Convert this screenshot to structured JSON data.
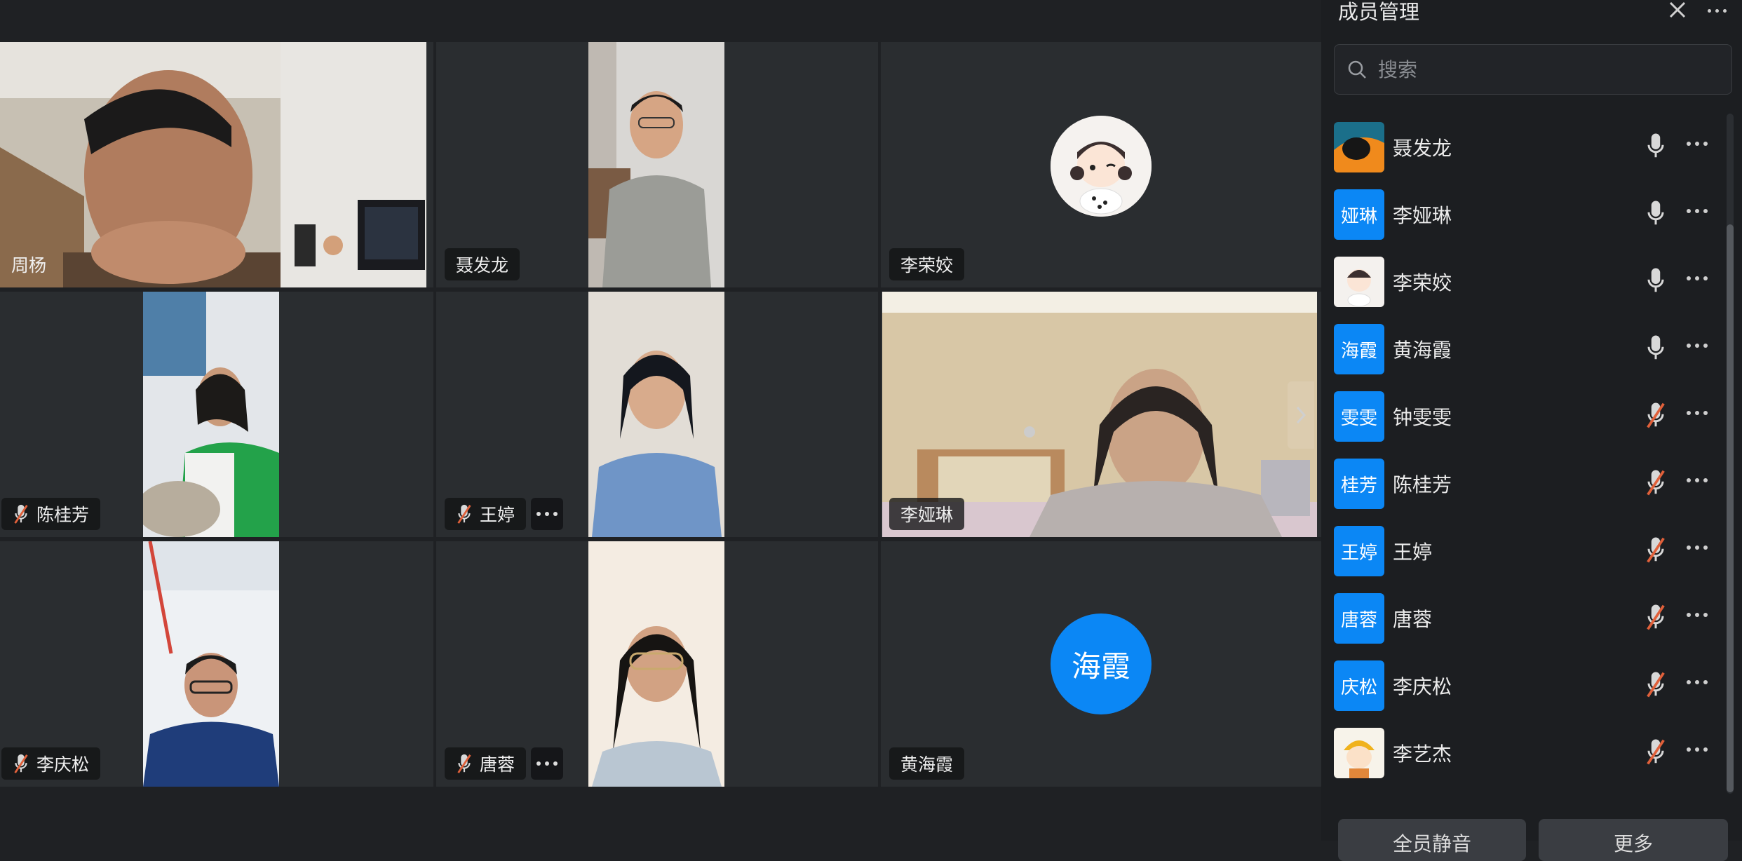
{
  "panel": {
    "title": "成员管理",
    "search_placeholder": "搜索",
    "buttons": {
      "mute_all": "全员静音",
      "more": "更多"
    },
    "members": [
      {
        "name": "聂发龙",
        "avatar_type": "image",
        "avatar_text": "",
        "mic": "on"
      },
      {
        "name": "李娅琳",
        "avatar_type": "text",
        "avatar_text": "娅琳",
        "mic": "on"
      },
      {
        "name": "李荣姣",
        "avatar_type": "image",
        "avatar_text": "",
        "mic": "on"
      },
      {
        "name": "黄海霞",
        "avatar_type": "text",
        "avatar_text": "海霞",
        "mic": "on"
      },
      {
        "name": "钟雯雯",
        "avatar_type": "text",
        "avatar_text": "雯雯",
        "mic": "muted"
      },
      {
        "name": "陈桂芳",
        "avatar_type": "text",
        "avatar_text": "桂芳",
        "mic": "muted"
      },
      {
        "name": "王婷",
        "avatar_type": "text",
        "avatar_text": "王婷",
        "mic": "muted"
      },
      {
        "name": "唐蓉",
        "avatar_type": "text",
        "avatar_text": "唐蓉",
        "mic": "muted"
      },
      {
        "name": "李庆松",
        "avatar_type": "text",
        "avatar_text": "庆松",
        "mic": "muted"
      },
      {
        "name": "李艺杰",
        "avatar_type": "image",
        "avatar_text": "",
        "mic": "muted"
      }
    ]
  },
  "tiles": {
    "t1": {
      "name": "周杨"
    },
    "t2": {
      "name": "聂发龙"
    },
    "t3": {
      "name": "李荣姣"
    },
    "t4": {
      "name": "陈桂芳"
    },
    "t5": {
      "name": "王婷"
    },
    "t6": {
      "name": "李娅琳"
    },
    "t7": {
      "name": "李庆松"
    },
    "t8": {
      "name": "唐蓉"
    },
    "t9": {
      "name": "黄海霞",
      "avatar_text": "海霞"
    }
  },
  "colors": {
    "accent": "#0b87f5",
    "muted_icon": "#e0603a"
  }
}
